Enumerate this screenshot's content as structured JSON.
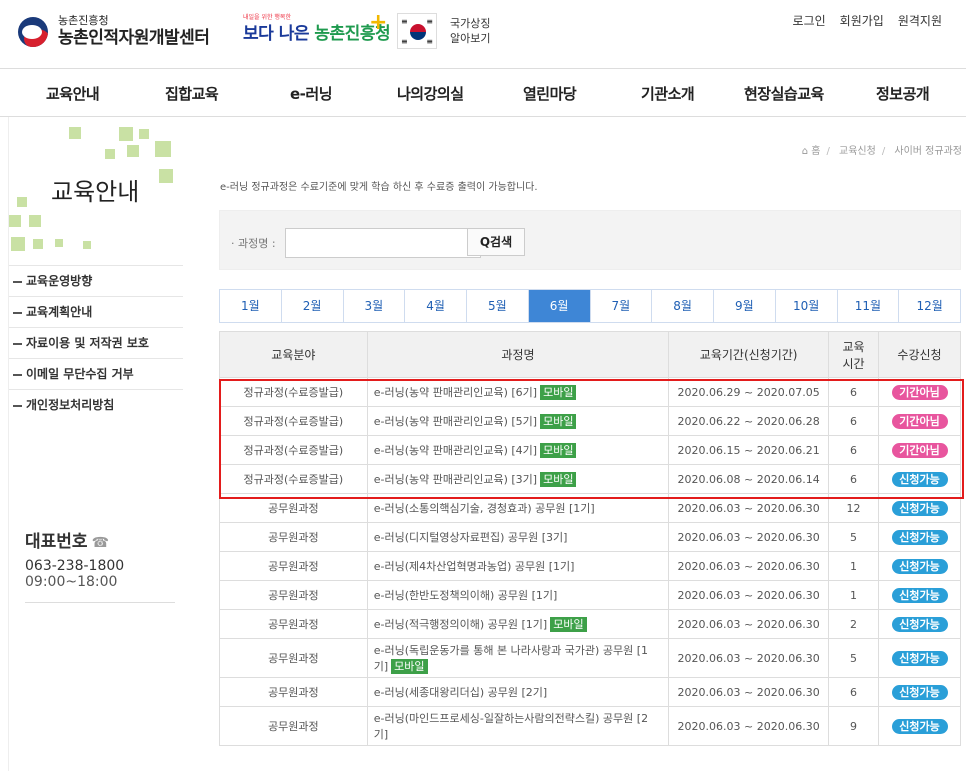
{
  "header": {
    "org_small": "농촌진흥청",
    "org_big": "농촌인적자원개발센터",
    "mid_small": "내일을 위한 행복한",
    "mid_big_a": "보다 나은",
    "mid_big_b": "농촌진흥청",
    "flag_line1": "국가상징",
    "flag_line2": "알아보기",
    "top_links": [
      "로그인",
      "회원가입",
      "원격지원"
    ]
  },
  "nav": [
    "교육안내",
    "집합교육",
    "e-러닝",
    "나의강의실",
    "열린마당",
    "기관소개",
    "현장실습교육",
    "정보공개"
  ],
  "sidebar": {
    "title": "교육안내",
    "items": [
      "교육운영방향",
      "교육계획안내",
      "자료이용 및 저작권 보호",
      "이메일 무단수집 거부",
      "개인정보처리방침"
    ],
    "contact_title": "대표번호",
    "contact_phone": "063-238-1800",
    "contact_hours": "09:00~18:00"
  },
  "breadcrumb": [
    "홈",
    "교육신청",
    "사이버 정규과정"
  ],
  "notice": "e-러닝 정규과정은 수료기준에 맞게 학습 하신 후 수료증 출력이 가능합니다.",
  "search": {
    "label": "· 과정명 :",
    "value": "",
    "button": "Q검색"
  },
  "months": [
    "1월",
    "2월",
    "3월",
    "4월",
    "5월",
    "6월",
    "7월",
    "8월",
    "9월",
    "10월",
    "11월",
    "12월"
  ],
  "active_month": "6월",
  "table": {
    "headers": [
      "교육분야",
      "과정명",
      "교육기간(신청기간)",
      "교육 시간",
      "수강신청"
    ],
    "mobile_label": "모바일",
    "rows": [
      {
        "field": "정규과정(수료증발급)",
        "name": "e-러닝(농약 판매관리인교육) [6기]",
        "mobile": true,
        "period": "2020.06.29 ~ 2020.07.05",
        "hours": "6",
        "status": "기간아님"
      },
      {
        "field": "정규과정(수료증발급)",
        "name": "e-러닝(농약 판매관리인교육) [5기]",
        "mobile": true,
        "period": "2020.06.22 ~ 2020.06.28",
        "hours": "6",
        "status": "기간아님"
      },
      {
        "field": "정규과정(수료증발급)",
        "name": "e-러닝(농약 판매관리인교육) [4기]",
        "mobile": true,
        "period": "2020.06.15 ~ 2020.06.21",
        "hours": "6",
        "status": "기간아님"
      },
      {
        "field": "정규과정(수료증발급)",
        "name": "e-러닝(농약 판매관리인교육) [3기]",
        "mobile": true,
        "period": "2020.06.08 ~ 2020.06.14",
        "hours": "6",
        "status": "신청가능"
      },
      {
        "field": "공무원과정",
        "name": "e-러닝(소통의핵심기술, 경청효과) 공무원 [1기]",
        "mobile": false,
        "period": "2020.06.03 ~ 2020.06.30",
        "hours": "12",
        "status": "신청가능"
      },
      {
        "field": "공무원과정",
        "name": "e-러닝(디지털영상자료편집) 공무원 [3기]",
        "mobile": false,
        "period": "2020.06.03 ~ 2020.06.30",
        "hours": "5",
        "status": "신청가능"
      },
      {
        "field": "공무원과정",
        "name": "e-러닝(제4차산업혁명과농업) 공무원 [1기]",
        "mobile": false,
        "period": "2020.06.03 ~ 2020.06.30",
        "hours": "1",
        "status": "신청가능"
      },
      {
        "field": "공무원과정",
        "name": "e-러닝(한반도정책의이해) 공무원 [1기]",
        "mobile": false,
        "period": "2020.06.03 ~ 2020.06.30",
        "hours": "1",
        "status": "신청가능"
      },
      {
        "field": "공무원과정",
        "name": "e-러닝(적극행정의이해) 공무원 [1기]",
        "mobile": true,
        "period": "2020.06.03 ~ 2020.06.30",
        "hours": "2",
        "status": "신청가능"
      },
      {
        "field": "공무원과정",
        "name": "e-러닝(독립운동가를 통해 본 나라사랑과 국가관) 공무원 [1기]",
        "mobile": true,
        "period": "2020.06.03 ~ 2020.06.30",
        "hours": "5",
        "status": "신청가능",
        "tall": true
      },
      {
        "field": "공무원과정",
        "name": "e-러닝(세종대왕리더십) 공무원 [2기]",
        "mobile": false,
        "period": "2020.06.03 ~ 2020.06.30",
        "hours": "6",
        "status": "신청가능"
      },
      {
        "field": "공무원과정",
        "name": "e-러닝(마인드프로세싱-일잘하는사람의전략스킬) 공무원 [2기]",
        "mobile": false,
        "period": "2020.06.03 ~ 2020.06.30",
        "hours": "9",
        "status": "신청가능",
        "tall": true
      }
    ]
  }
}
